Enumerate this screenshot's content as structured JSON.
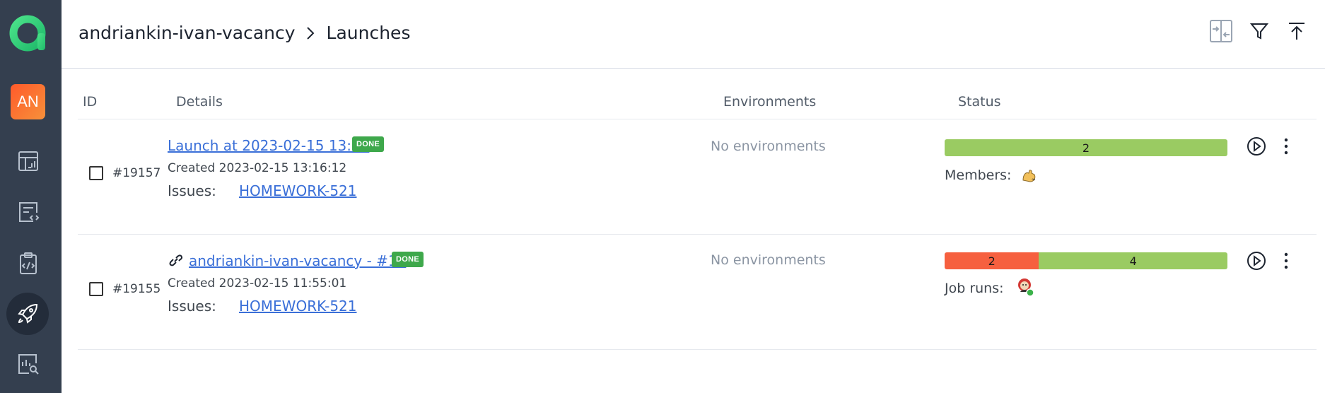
{
  "breadcrumb": {
    "project": "andriankin-ivan-vacancy",
    "page": "Launches"
  },
  "sidebar": {
    "avatar_initials": "AN",
    "items": [
      {
        "icon": "dashboard-icon"
      },
      {
        "icon": "code-review-icon"
      },
      {
        "icon": "checklist-icon"
      },
      {
        "icon": "rocket-icon",
        "active": true
      },
      {
        "icon": "analytics-search-icon"
      }
    ]
  },
  "header_actions": [
    {
      "icon": "compare-icon"
    },
    {
      "icon": "filter-icon"
    },
    {
      "icon": "upload-icon"
    }
  ],
  "table": {
    "columns": [
      "ID",
      "Details",
      "Environments",
      "Status"
    ],
    "rows": [
      {
        "id": "#19157",
        "title": "Launch at 2023-02-15 13:15",
        "has_link_icon": false,
        "badge": "DONE",
        "created": "Created 2023-02-15 13:16:12",
        "issues_label": "Issues:",
        "issue": "HOMEWORK-521",
        "environments": "No environments",
        "status_segments": [
          {
            "value": "2",
            "color": "#9acb62"
          }
        ],
        "meta_label": "Members:"
      },
      {
        "id": "#19155",
        "title": "andriankin-ivan-vacancy - #16",
        "has_link_icon": true,
        "badge": "DONE",
        "created": "Created 2023-02-15 11:55:01",
        "issues_label": "Issues:",
        "issue": "HOMEWORK-521",
        "environments": "No environments",
        "status_segments": [
          {
            "value": "2",
            "color": "#f6603f"
          },
          {
            "value": "4",
            "color": "#9acb62"
          }
        ],
        "meta_label": "Job runs:"
      }
    ]
  },
  "colors": {
    "sidebar_bg": "#343f4f",
    "link": "#3a6fd8",
    "done_badge": "#3ea84b",
    "passed": "#9acb62",
    "failed": "#f6603f"
  }
}
